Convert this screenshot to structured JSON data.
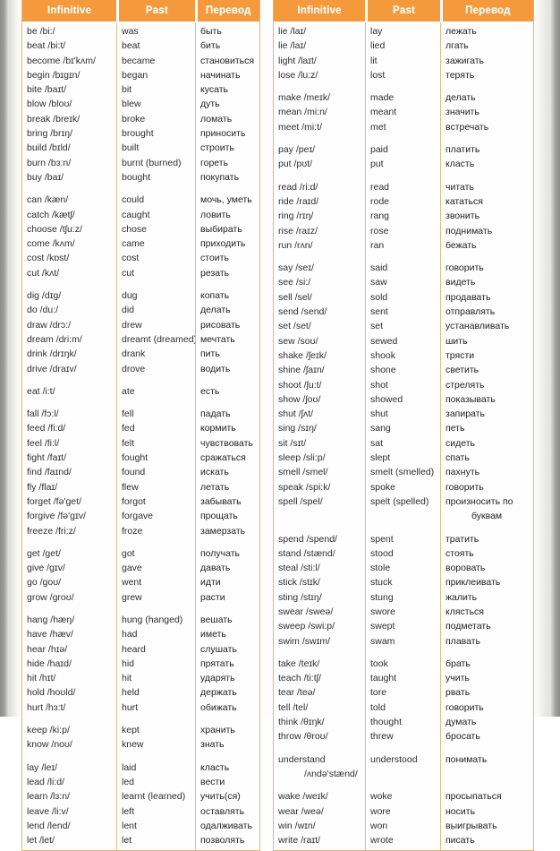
{
  "page": {
    "title": "Irregular Verbs Table",
    "accent_color": "#f59a3c",
    "border_color": "#e0b878",
    "paper_color": "#fdfdfb"
  },
  "tables": [
    {
      "id": "left",
      "headers": {
        "infinitive": "Infinitive",
        "past": "Past",
        "translation": "Перевод"
      },
      "groups": [
        {
          "rows": [
            {
              "infinitive": "be /bi:/",
              "past": "was",
              "ru": "быть"
            },
            {
              "infinitive": "beat /bi:t/",
              "past": "beat",
              "ru": "бить"
            },
            {
              "infinitive": "become /bɪ'kʌm/",
              "past": "became",
              "ru": "становиться"
            },
            {
              "infinitive": "begin /bɪgɪn/",
              "past": "began",
              "ru": "начинать"
            },
            {
              "infinitive": "bite /baɪt/",
              "past": "bit",
              "ru": "кусать"
            },
            {
              "infinitive": "blow /bloʊ/",
              "past": "blew",
              "ru": "дуть"
            },
            {
              "infinitive": "break /breɪk/",
              "past": "broke",
              "ru": "ломать"
            },
            {
              "infinitive": "bring /brɪŋ/",
              "past": "brought",
              "ru": "приносить"
            },
            {
              "infinitive": "build /bɪld/",
              "past": "built",
              "ru": "строить"
            },
            {
              "infinitive": "burn /bɜ:n/",
              "past": "burnt (burned)",
              "ru": "гореть"
            },
            {
              "infinitive": "buy /baɪ/",
              "past": "bought",
              "ru": "покупать"
            }
          ]
        },
        {
          "rows": [
            {
              "infinitive": "can /kæn/",
              "past": "could",
              "ru": "мочь, уметь"
            },
            {
              "infinitive": "catch /kætʃ/",
              "past": "caught",
              "ru": "ловить"
            },
            {
              "infinitive": "choose /tʃu:z/",
              "past": "chose",
              "ru": "выбирать"
            },
            {
              "infinitive": "come /kʌm/",
              "past": "came",
              "ru": "приходить"
            },
            {
              "infinitive": "cost /kɒst/",
              "past": "cost",
              "ru": "стоить"
            },
            {
              "infinitive": "cut /kʌt/",
              "past": "cut",
              "ru": "резать"
            }
          ]
        },
        {
          "rows": [
            {
              "infinitive": "dig /dɪg/",
              "past": "dug",
              "ru": "копать"
            },
            {
              "infinitive": "do /du:/",
              "past": "did",
              "ru": "делать"
            },
            {
              "infinitive": "draw /drɔ:/",
              "past": "drew",
              "ru": "рисовать"
            },
            {
              "infinitive": "dream /dri:m/",
              "past": "dreamt (dreamed)",
              "ru": "мечтать"
            },
            {
              "infinitive": "drink /drɪŋk/",
              "past": "drank",
              "ru": "пить"
            },
            {
              "infinitive": "drive /draɪv/",
              "past": "drove",
              "ru": "водить"
            }
          ]
        },
        {
          "rows": [
            {
              "infinitive": "eat /i:t/",
              "past": "ate",
              "ru": "есть"
            }
          ]
        },
        {
          "rows": [
            {
              "infinitive": "fall /fɔ:l/",
              "past": "fell",
              "ru": "падать"
            },
            {
              "infinitive": "feed /fi:d/",
              "past": "fed",
              "ru": "кормить"
            },
            {
              "infinitive": "feel /fi:l/",
              "past": "felt",
              "ru": "чувствовать"
            },
            {
              "infinitive": "fight /faɪt/",
              "past": "fought",
              "ru": "сражаться"
            },
            {
              "infinitive": "find /faɪnd/",
              "past": "found",
              "ru": "искать"
            },
            {
              "infinitive": "fly /flaɪ/",
              "past": "flew",
              "ru": "летать"
            },
            {
              "infinitive": "forget /fə'get/",
              "past": "forgot",
              "ru": "забывать"
            },
            {
              "infinitive": "forgive /fə'gɪv/",
              "past": "forgave",
              "ru": "прощать"
            },
            {
              "infinitive": "freeze /fri:z/",
              "past": "froze",
              "ru": "замерзать"
            }
          ]
        },
        {
          "rows": [
            {
              "infinitive": "get /get/",
              "past": "got",
              "ru": "получать"
            },
            {
              "infinitive": "give /gɪv/",
              "past": "gave",
              "ru": "давать"
            },
            {
              "infinitive": "go /goʊ/",
              "past": "went",
              "ru": "идти"
            },
            {
              "infinitive": "grow /groʊ/",
              "past": "grew",
              "ru": "расти"
            }
          ]
        },
        {
          "rows": [
            {
              "infinitive": "hang /hæŋ/",
              "past": "hung (hanged)",
              "ru": "вешать"
            },
            {
              "infinitive": "have /hæv/",
              "past": "had",
              "ru": "иметь"
            },
            {
              "infinitive": "hear /hɪə/",
              "past": "heard",
              "ru": "слушать"
            },
            {
              "infinitive": "hide /haɪd/",
              "past": "hid",
              "ru": "прятать"
            },
            {
              "infinitive": "hit /hɪt/",
              "past": "hit",
              "ru": "ударять"
            },
            {
              "infinitive": "hold /hoʊld/",
              "past": "held",
              "ru": "держать"
            },
            {
              "infinitive": "hurt /hɜ:t/",
              "past": "hurt",
              "ru": "обижать"
            }
          ]
        },
        {
          "rows": [
            {
              "infinitive": "keep /ki:p/",
              "past": "kept",
              "ru": "хранить"
            },
            {
              "infinitive": "know /noʊ/",
              "past": "knew",
              "ru": "знать"
            }
          ]
        },
        {
          "rows": [
            {
              "infinitive": "lay /leɪ/",
              "past": "laid",
              "ru": "класть"
            },
            {
              "infinitive": "lead /li:d/",
              "past": "led",
              "ru": "вести"
            },
            {
              "infinitive": "learn /lɜ:n/",
              "past": "learnt (learned)",
              "ru": "учить(ся)"
            },
            {
              "infinitive": "leave /li:v/",
              "past": "left",
              "ru": "оставлять"
            },
            {
              "infinitive": "lend /lend/",
              "past": "lent",
              "ru": "одалживать"
            },
            {
              "infinitive": "let /let/",
              "past": "let",
              "ru": "позволять"
            }
          ]
        }
      ]
    },
    {
      "id": "right",
      "headers": {
        "infinitive": "Infinitive",
        "past": "Past",
        "translation": "Перевод"
      },
      "groups": [
        {
          "rows": [
            {
              "infinitive": "lie /laɪ/",
              "past": "lay",
              "ru": "лежать"
            },
            {
              "infinitive": "lie /laɪ/",
              "past": "lied",
              "ru": "лгать"
            },
            {
              "infinitive": "light /laɪt/",
              "past": "lit",
              "ru": "зажигать"
            },
            {
              "infinitive": "lose /lu:z/",
              "past": "lost",
              "ru": "терять"
            }
          ]
        },
        {
          "rows": [
            {
              "infinitive": "make /meɪk/",
              "past": "made",
              "ru": "делать"
            },
            {
              "infinitive": "mean /mi:n/",
              "past": "meant",
              "ru": "значить"
            },
            {
              "infinitive": "meet /mi:t/",
              "past": "met",
              "ru": "встречать"
            }
          ]
        },
        {
          "rows": [
            {
              "infinitive": "pay /peɪ/",
              "past": "paid",
              "ru": "платить"
            },
            {
              "infinitive": "put /pʊt/",
              "past": "put",
              "ru": "класть"
            }
          ]
        },
        {
          "rows": [
            {
              "infinitive": "read /ri:d/",
              "past": "read",
              "ru": "читать"
            },
            {
              "infinitive": "ride /raɪd/",
              "past": "rode",
              "ru": "кататься"
            },
            {
              "infinitive": "ring /rɪŋ/",
              "past": "rang",
              "ru": "звонить"
            },
            {
              "infinitive": "rise /raɪz/",
              "past": "rose",
              "ru": "поднимать"
            },
            {
              "infinitive": "run /rʌn/",
              "past": "ran",
              "ru": "бежать"
            }
          ]
        },
        {
          "rows": [
            {
              "infinitive": "say /seɪ/",
              "past": "said",
              "ru": "говорить"
            },
            {
              "infinitive": "see /si:/",
              "past": "saw",
              "ru": "видеть"
            },
            {
              "infinitive": "sell /sel/",
              "past": "sold",
              "ru": "продавать"
            },
            {
              "infinitive": "send /send/",
              "past": "sent",
              "ru": "отправлять"
            },
            {
              "infinitive": "set /set/",
              "past": "set",
              "ru": "устанавливать"
            },
            {
              "infinitive": "sew /soʊ/",
              "past": "sewed",
              "ru": "шить"
            },
            {
              "infinitive": "shake /ʃeɪk/",
              "past": "shook",
              "ru": "трясти"
            },
            {
              "infinitive": "shine /ʃaɪn/",
              "past": "shone",
              "ru": "светить"
            },
            {
              "infinitive": "shoot /ʃu:t/",
              "past": "shot",
              "ru": "стрелять"
            },
            {
              "infinitive": "show /ʃoʊ/",
              "past": "showed",
              "ru": "показывать"
            },
            {
              "infinitive": "shut /ʃʌt/",
              "past": "shut",
              "ru": "запирать"
            },
            {
              "infinitive": "sing /sɪŋ/",
              "past": "sang",
              "ru": "петь"
            },
            {
              "infinitive": "sit /sɪt/",
              "past": "sat",
              "ru": "сидеть"
            },
            {
              "infinitive": "sleep /sli:p/",
              "past": "slept",
              "ru": "спать"
            },
            {
              "infinitive": "smell /smel/",
              "past": "smelt (smelled)",
              "ru": "пахнуть"
            },
            {
              "infinitive": "speak /spi:k/",
              "past": "spoke",
              "ru": "говорить"
            },
            {
              "infinitive": "spell /spel/",
              "past": "spelt (spelled)",
              "ru": "произносить по"
            },
            {
              "infinitive": "",
              "past": "",
              "ru": "буквам",
              "ru_indent": true
            }
          ]
        },
        {
          "rows": [
            {
              "infinitive": "spend /spend/",
              "past": "spent",
              "ru": "тратить"
            },
            {
              "infinitive": "stand /stænd/",
              "past": "stood",
              "ru": "стоять"
            },
            {
              "infinitive": "steal /sti:l/",
              "past": "stole",
              "ru": "воровать"
            },
            {
              "infinitive": "stick /stɪk/",
              "past": "stuck",
              "ru": "приклеивать"
            },
            {
              "infinitive": "sting /stɪŋ/",
              "past": "stung",
              "ru": "жалить"
            },
            {
              "infinitive": "swear /sweə/",
              "past": "swore",
              "ru": "клясться"
            },
            {
              "infinitive": "sweep /swi:p/",
              "past": "swept",
              "ru": "подметать"
            },
            {
              "infinitive": "swim /swɪm/",
              "past": "swam",
              "ru": "плавать"
            }
          ]
        },
        {
          "rows": [
            {
              "infinitive": "take /teɪk/",
              "past": "took",
              "ru": "брать"
            },
            {
              "infinitive": "teach /ti:tʃ/",
              "past": "taught",
              "ru": "учить"
            },
            {
              "infinitive": "tear /teə/",
              "past": "tore",
              "ru": "рвать"
            },
            {
              "infinitive": "tell /tel/",
              "past": "told",
              "ru": "говорить"
            },
            {
              "infinitive": "think /θɪŋk/",
              "past": "thought",
              "ru": "думать"
            },
            {
              "infinitive": "throw /θroʊ/",
              "past": "threw",
              "ru": "бросать"
            }
          ]
        },
        {
          "rows": [
            {
              "infinitive": "understand",
              "past": "understood",
              "ru": "понимать"
            },
            {
              "infinitive": "/ʌndə'stænd/",
              "past": "",
              "ru": "",
              "inf_indent": true
            }
          ]
        },
        {
          "rows": [
            {
              "infinitive": "wake /weɪk/",
              "past": "woke",
              "ru": "просыпаться"
            },
            {
              "infinitive": "wear /weə/",
              "past": "wore",
              "ru": "носить"
            },
            {
              "infinitive": "win /wɪn/",
              "past": "won",
              "ru": "выигрывать"
            },
            {
              "infinitive": "write /raɪt/",
              "past": "wrote",
              "ru": "писать"
            }
          ]
        }
      ]
    }
  ]
}
